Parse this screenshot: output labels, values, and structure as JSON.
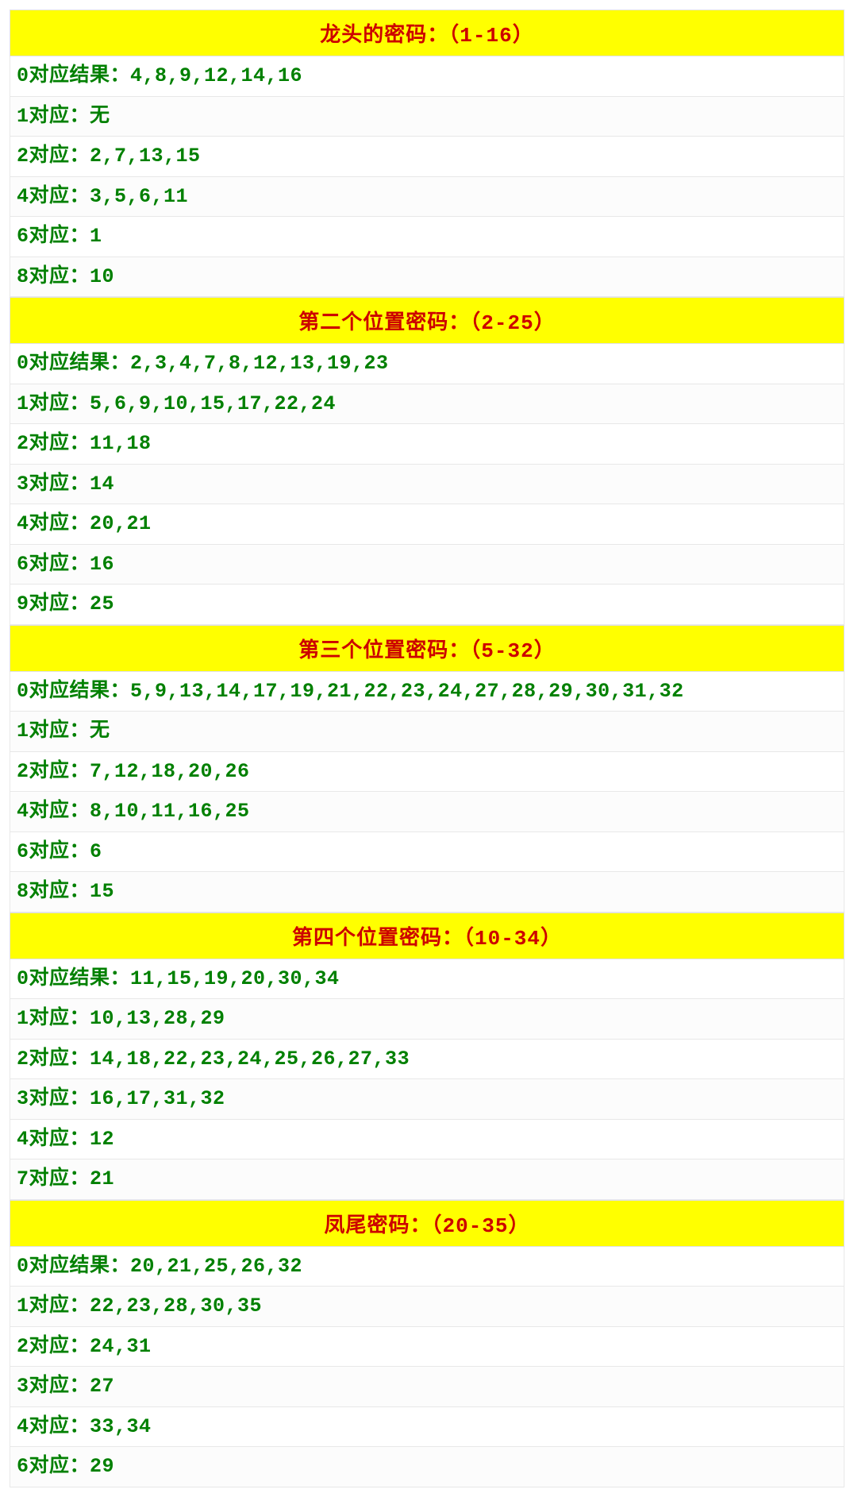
{
  "sections": [
    {
      "title": "龙头的密码：（1-16）",
      "rows": [
        "0对应结果：4,8,9,12,14,16",
        "1对应：无",
        "2对应：2,7,13,15",
        "4对应：3,5,6,11",
        "6对应：1",
        "8对应：10"
      ]
    },
    {
      "title": "第二个位置密码：（2-25）",
      "rows": [
        "0对应结果：2,3,4,7,8,12,13,19,23",
        "1对应：5,6,9,10,15,17,22,24",
        "2对应：11,18",
        "3对应：14",
        "4对应：20,21",
        "6对应：16",
        "9对应：25"
      ]
    },
    {
      "title": "第三个位置密码：（5-32）",
      "rows": [
        "0对应结果：5,9,13,14,17,19,21,22,23,24,27,28,29,30,31,32",
        "1对应：无",
        "2对应：7,12,18,20,26",
        "4对应：8,10,11,16,25",
        "6对应：6",
        "8对应：15"
      ]
    },
    {
      "title": "第四个位置密码：（10-34）",
      "rows": [
        "0对应结果：11,15,19,20,30,34",
        "1对应：10,13,28,29",
        "2对应：14,18,22,23,24,25,26,27,33",
        "3对应：16,17,31,32",
        "4对应：12",
        "7对应：21"
      ]
    },
    {
      "title": "凤尾密码：（20-35）",
      "rows": [
        "0对应结果：20,21,25,26,32",
        "1对应：22,23,28,30,35",
        "2对应：24,31",
        "3对应：27",
        "4对应：33,34",
        "6对应：29"
      ]
    }
  ]
}
